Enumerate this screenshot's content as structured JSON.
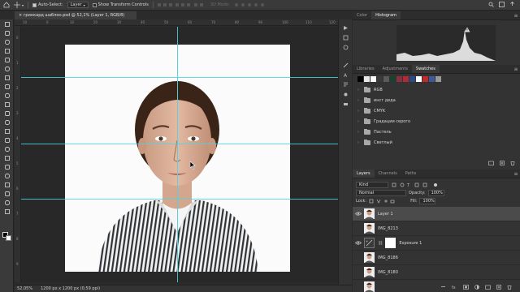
{
  "options_bar": {
    "auto_select_label": "Auto-Select:",
    "auto_select_checked": true,
    "auto_select_target": "Layer",
    "show_transform_label": "Show Transform Controls",
    "show_transform_checked": false,
    "mode_3d_label": "3D Mode:"
  },
  "document": {
    "tab_title": "гринкард шаблон.psd @ 52,1% (Layer 1, RGB/8)",
    "tab_close": "×"
  },
  "rulers": {
    "top": [
      "10",
      "0",
      "10",
      "20",
      "30",
      "40",
      "50",
      "60",
      "70",
      "80",
      "90",
      "100",
      "110",
      "120"
    ],
    "left": [
      "0",
      "1",
      "2",
      "3",
      "4",
      "5",
      "6",
      "7",
      "8",
      "9"
    ]
  },
  "status": {
    "zoom": "52,05%",
    "doc_info": "1200 px x 1200 px (0,59 ppi)"
  },
  "panels": {
    "top_tabs": [
      "Color",
      "Histogram"
    ],
    "top_active": "Histogram",
    "mid_tabs": [
      "Libraries",
      "Adjustments",
      "Swatches"
    ],
    "mid_active": "Swatches",
    "swatch_colors": [
      "#000000",
      "#e8e8e8",
      "#ffffff",
      "#3a3a3a",
      "#5b5b5b",
      "#1a4030",
      "#8a3040",
      "#b02a3a",
      "#2a4a8a",
      "#ffffff",
      "#c42a2a",
      "#3a5a9a",
      "#9a9a9a"
    ],
    "swatch_folders": [
      "RGB",
      "инст деда",
      "CMYK",
      "Градации серого",
      "Пастель",
      "Светлый"
    ],
    "layer_tabs": [
      "Layers",
      "Channels",
      "Paths"
    ],
    "layer_active": "Layers",
    "kind_label": "Kind",
    "blend_mode": "Normal",
    "opacity_label": "Opacity:",
    "opacity_value": "100%",
    "lock_label": "Lock:",
    "fill_label": "Fill:",
    "fill_value": "100%",
    "layers": [
      {
        "name": "Layer 1",
        "visible": true,
        "selected": true,
        "type": "photo"
      },
      {
        "name": "IMG_8213",
        "visible": false,
        "selected": false,
        "type": "photo"
      },
      {
        "name": "Exposure 1",
        "visible": true,
        "selected": false,
        "type": "adjustment"
      },
      {
        "name": "IMG_8186",
        "visible": false,
        "selected": false,
        "type": "photo"
      },
      {
        "name": "IMG_8180",
        "visible": false,
        "selected": false,
        "type": "photo"
      },
      {
        "name": "",
        "visible": false,
        "selected": false,
        "type": "photo"
      }
    ]
  },
  "icons": {
    "tools": [
      "move-tool-icon",
      "artboard-icon",
      "lasso-icon",
      "quick-select-icon",
      "crop-icon",
      "frame-icon",
      "eyedropper-icon",
      "healing-brush-icon",
      "brush-icon",
      "clone-stamp-icon",
      "history-brush-icon",
      "eraser-icon",
      "gradient-icon",
      "blur-icon",
      "dodge-icon",
      "pen-icon",
      "type-icon",
      "path-select-icon",
      "rectangle-icon",
      "hand-icon",
      "zoom-icon",
      "more-tools-icon"
    ]
  }
}
